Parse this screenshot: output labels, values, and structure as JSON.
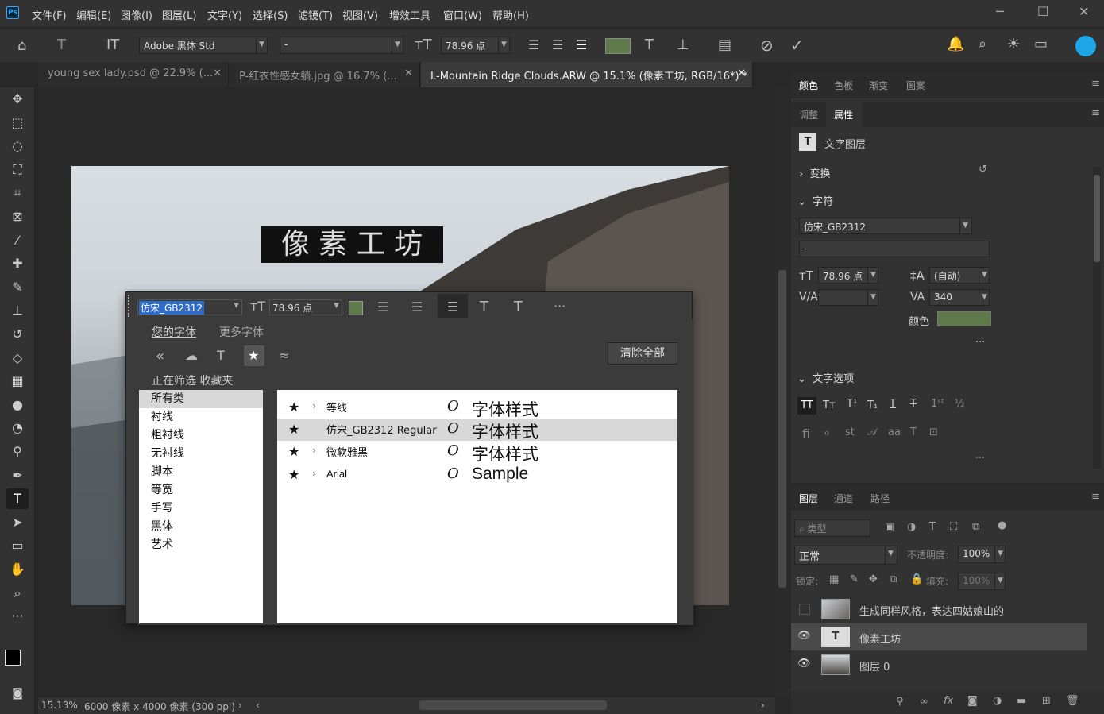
{
  "app": {
    "logo": "Ps",
    "accent": "#31a8ff",
    "swatch_color": "#5f7a4a"
  },
  "menu": [
    "文件(F)",
    "编辑(E)",
    "图像(I)",
    "图层(L)",
    "文字(Y)",
    "选择(S)",
    "滤镜(T)",
    "视图(V)",
    "增效工具",
    "窗口(W)",
    "帮助(H)"
  ],
  "options": {
    "font_family": "Adobe 黑体 Std",
    "font_style": "-",
    "font_size": "78.96 点"
  },
  "tabs": [
    {
      "label": "young sex lady.psd @ 22.9% (..."
    },
    {
      "label": "P-红衣性感女躺.jpg @ 16.7% (..."
    },
    {
      "label": "L-Mountain Ridge Clouds.ARW @ 15.1% (像素工坊, RGB/16*) *"
    }
  ],
  "canvas_text": "像 素 工 坊",
  "status": {
    "zoom": "15.13%",
    "doc_info": "6000 像素 x 4000 像素 (300 ppi)"
  },
  "popup": {
    "font_value": "仿宋_GB2312",
    "size_value": "78.96 点",
    "tab_your_fonts": "您的字体",
    "tab_more_fonts": "更多字体",
    "clear_all": "清除全部",
    "filter_label": "正在筛选 收藏夹",
    "categories": [
      "所有类",
      "衬线",
      "粗衬线",
      "无衬线",
      "脚本",
      "等宽",
      "手写",
      "黑体",
      "艺术"
    ],
    "fonts": [
      {
        "name": "等线",
        "has_children": true,
        "sample": "字体样式"
      },
      {
        "name": "仿宋_GB2312 Regular",
        "has_children": false,
        "sample": "字体样式"
      },
      {
        "name": "微软雅黑",
        "has_children": true,
        "sample": "字体样式"
      },
      {
        "name": "Arial",
        "has_children": true,
        "sample": "Sample"
      }
    ]
  },
  "panels": {
    "top_tabs": [
      "颜色",
      "色板",
      "渐变",
      "图案"
    ],
    "props_tabs": [
      "调整",
      "属性"
    ],
    "text_layer_label": "文字图层",
    "transform": "变换",
    "character": "字符",
    "char_font": "仿宋_GB2312",
    "char_style": "-",
    "char_size": "78.96 点",
    "leading": "(自动)",
    "tracking": "340",
    "color_label": "颜色",
    "text_options": "文字选项",
    "layers_tabs": [
      "图层",
      "通道",
      "路径"
    ],
    "kind_placeholder": "类型",
    "blend_mode": "正常",
    "opacity_label": "不透明度:",
    "opacity": "100%",
    "lock_label": "锁定:",
    "fill_label": "填充:",
    "fill": "100%",
    "layers": [
      {
        "name": "生成同样风格，表达四姑娘山的",
        "visible": false
      },
      {
        "name": "像素工坊",
        "visible": true,
        "selected": true
      },
      {
        "name": "图层 0",
        "visible": true
      }
    ]
  }
}
